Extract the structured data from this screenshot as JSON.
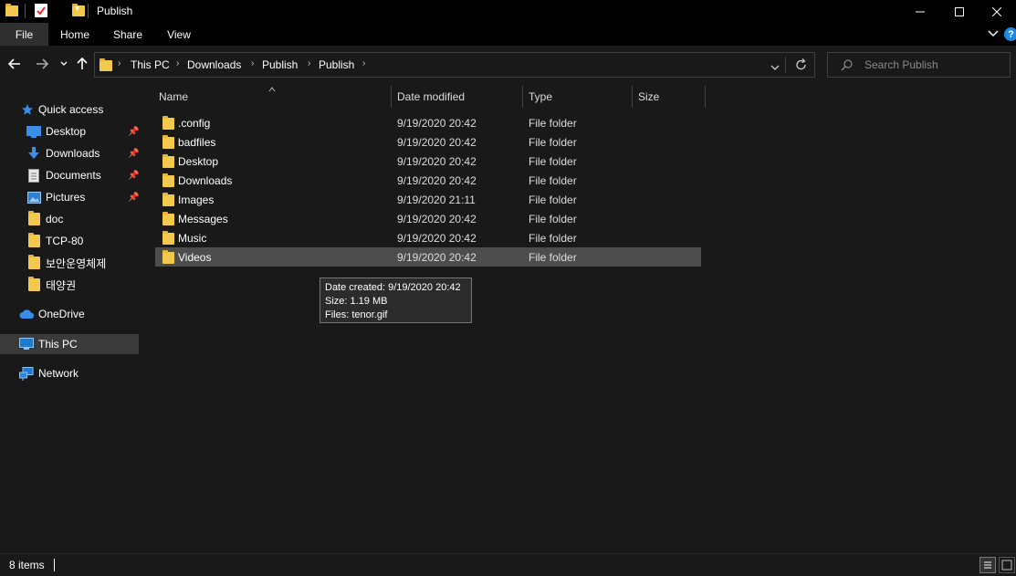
{
  "window": {
    "title": "Publish",
    "quick_access_down_glyph": "▾"
  },
  "ribbon": {
    "tabs": [
      "File",
      "Home",
      "Share",
      "View"
    ]
  },
  "address": {
    "crumbs": [
      "This PC",
      "Downloads",
      "Publish",
      "Publish"
    ]
  },
  "search": {
    "placeholder": "Search Publish"
  },
  "sidebar": {
    "items": [
      {
        "label": "Quick access",
        "icon": "star-icon"
      },
      {
        "label": "Desktop",
        "icon": "desktop-icon",
        "pinned": true
      },
      {
        "label": "Downloads",
        "icon": "download-arrow-icon",
        "pinned": true
      },
      {
        "label": "Documents",
        "icon": "document-icon",
        "pinned": true
      },
      {
        "label": "Pictures",
        "icon": "pictures-icon",
        "pinned": true
      },
      {
        "label": "doc",
        "icon": "folder-icon"
      },
      {
        "label": "TCP-80",
        "icon": "folder-icon"
      },
      {
        "label": "보안운영체제",
        "icon": "folder-icon"
      },
      {
        "label": "태양권",
        "icon": "folder-icon"
      },
      {
        "label": "OneDrive",
        "icon": "cloud-icon"
      },
      {
        "label": "This PC",
        "icon": "computer-icon",
        "selected": true
      },
      {
        "label": "Network",
        "icon": "network-icon"
      }
    ]
  },
  "columns": {
    "name": "Name",
    "date": "Date modified",
    "type": "Type",
    "size": "Size"
  },
  "files": [
    {
      "name": ".config",
      "date": "9/19/2020 20:42",
      "type": "File folder"
    },
    {
      "name": "badfiles",
      "date": "9/19/2020 20:42",
      "type": "File folder"
    },
    {
      "name": "Desktop",
      "date": "9/19/2020 20:42",
      "type": "File folder"
    },
    {
      "name": "Downloads",
      "date": "9/19/2020 20:42",
      "type": "File folder"
    },
    {
      "name": "Images",
      "date": "9/19/2020 21:11",
      "type": "File folder"
    },
    {
      "name": "Messages",
      "date": "9/19/2020 20:42",
      "type": "File folder"
    },
    {
      "name": "Music",
      "date": "9/19/2020 20:42",
      "type": "File folder"
    },
    {
      "name": "Videos",
      "date": "9/19/2020 20:42",
      "type": "File folder",
      "hovered": true
    }
  ],
  "tooltip": {
    "line1": "Date created: 9/19/2020 20:42",
    "line2": "Size: 1.19 MB",
    "line3": "Files: tenor.gif"
  },
  "status": {
    "count": "8 items"
  },
  "colors": {
    "background": "#191919",
    "folder": "#f3c94d",
    "selected": "#3a3a3a",
    "accent": "#4aa3f0"
  }
}
